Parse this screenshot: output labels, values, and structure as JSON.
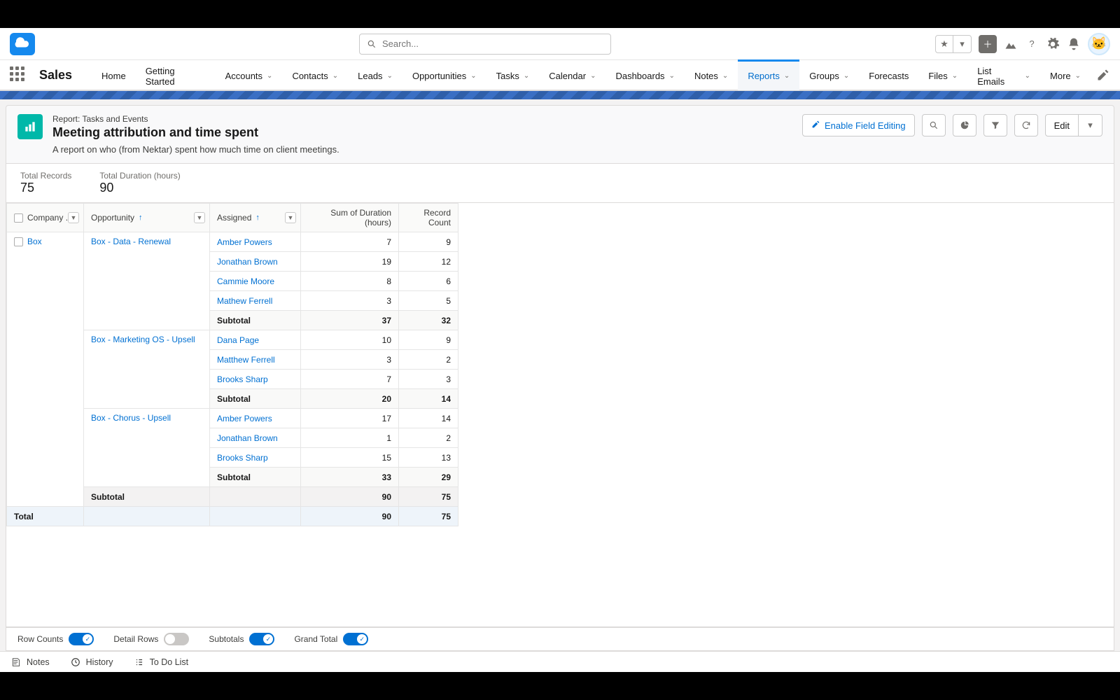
{
  "search": {
    "placeholder": "Search..."
  },
  "app_name": "Sales",
  "nav": {
    "items": [
      {
        "label": "Home"
      },
      {
        "label": "Getting Started"
      },
      {
        "label": "Accounts",
        "dropdown": true
      },
      {
        "label": "Contacts",
        "dropdown": true
      },
      {
        "label": "Leads",
        "dropdown": true
      },
      {
        "label": "Opportunities",
        "dropdown": true
      },
      {
        "label": "Tasks",
        "dropdown": true
      },
      {
        "label": "Calendar",
        "dropdown": true
      },
      {
        "label": "Dashboards",
        "dropdown": true
      },
      {
        "label": "Notes",
        "dropdown": true
      },
      {
        "label": "Reports",
        "dropdown": true,
        "active": true
      },
      {
        "label": "Groups",
        "dropdown": true
      },
      {
        "label": "Forecasts"
      },
      {
        "label": "Files",
        "dropdown": true
      },
      {
        "label": "List Emails",
        "dropdown": true
      },
      {
        "label": "More",
        "dropdown": true
      }
    ]
  },
  "report": {
    "crumb": "Report: Tasks and Events",
    "title": "Meeting attribution and time spent",
    "description": "A report on who (from Nektar) spent how much time on client meetings.",
    "enable_field_editing": "Enable Field Editing",
    "edit": "Edit"
  },
  "summary": {
    "total_records_label": "Total Records",
    "total_records_value": "75",
    "total_duration_label": "Total Duration (hours)",
    "total_duration_value": "90"
  },
  "columns": {
    "company": "Company ...",
    "opportunity": "Opportunity",
    "assigned": "Assigned",
    "duration": "Sum of Duration (hours)",
    "record_count": "Record Count"
  },
  "labels": {
    "subtotal": "Subtotal",
    "total": "Total"
  },
  "data": {
    "company": "Box",
    "opps": [
      {
        "name": "Box - Data - Renewal",
        "rows": [
          {
            "assigned": "Amber Powers",
            "dur": "7",
            "cnt": "9"
          },
          {
            "assigned": "Jonathan Brown",
            "dur": "19",
            "cnt": "12"
          },
          {
            "assigned": "Cammie Moore",
            "dur": "8",
            "cnt": "6"
          },
          {
            "assigned": "Mathew Ferrell",
            "dur": "3",
            "cnt": "5"
          }
        ],
        "subtotal": {
          "dur": "37",
          "cnt": "32"
        }
      },
      {
        "name": "Box - Marketing OS - Upsell",
        "rows": [
          {
            "assigned": "Dana Page",
            "dur": "10",
            "cnt": "9"
          },
          {
            "assigned": "Matthew Ferrell",
            "dur": "3",
            "cnt": "2"
          },
          {
            "assigned": "Brooks Sharp",
            "dur": "7",
            "cnt": "3"
          }
        ],
        "subtotal": {
          "dur": "20",
          "cnt": "14"
        }
      },
      {
        "name": "Box - Chorus - Upsell",
        "rows": [
          {
            "assigned": "Amber Powers",
            "dur": "17",
            "cnt": "14"
          },
          {
            "assigned": "Jonathan Brown",
            "dur": "1",
            "cnt": "2"
          },
          {
            "assigned": "Brooks Sharp",
            "dur": "15",
            "cnt": "13"
          }
        ],
        "subtotal": {
          "dur": "33",
          "cnt": "29"
        }
      }
    ],
    "company_subtotal": {
      "dur": "90",
      "cnt": "75"
    },
    "grand_total": {
      "dur": "90",
      "cnt": "75"
    }
  },
  "toggles": {
    "row_counts": "Row Counts",
    "detail_rows": "Detail Rows",
    "subtotals": "Subtotals",
    "grand_total": "Grand Total"
  },
  "bottombar": {
    "notes": "Notes",
    "history": "History",
    "todo": "To Do List"
  }
}
